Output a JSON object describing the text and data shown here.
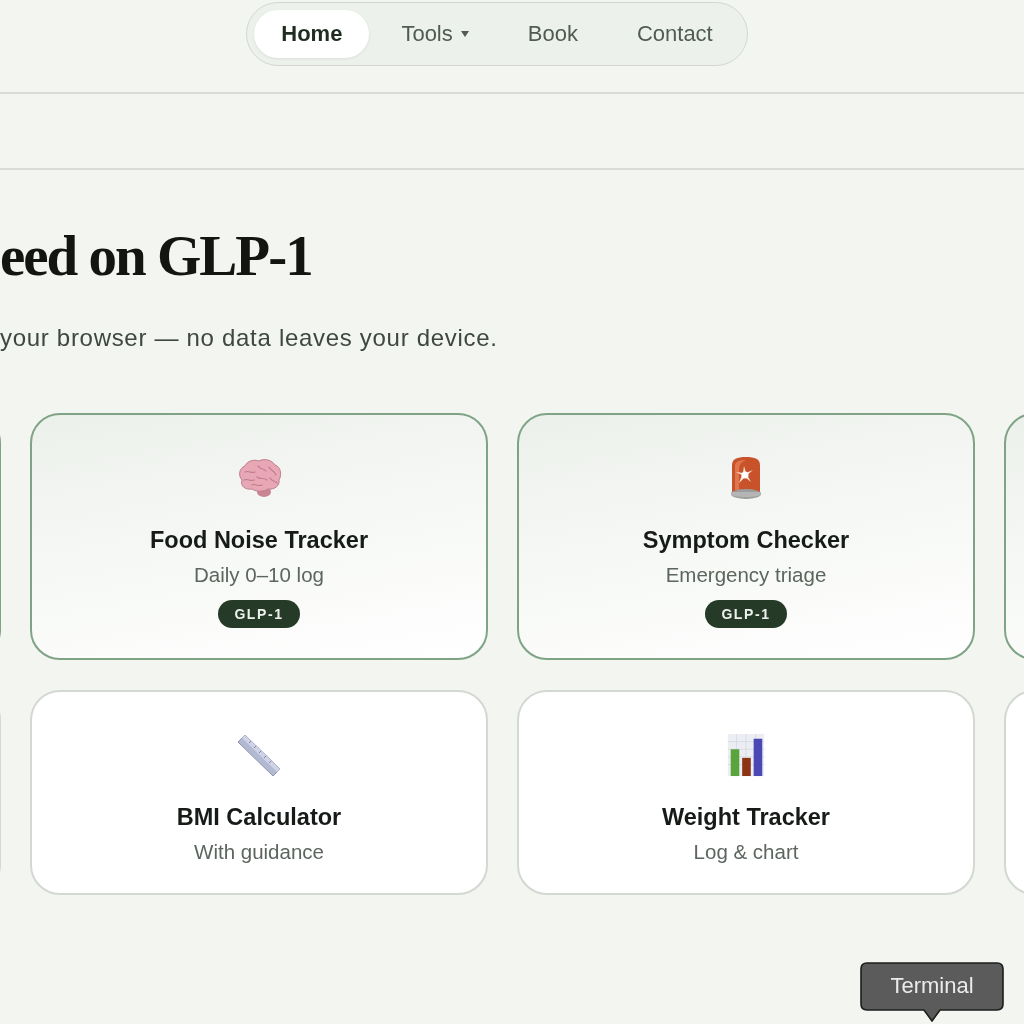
{
  "nav": {
    "items": [
      {
        "label": "Home",
        "selected": true,
        "dropdown": false
      },
      {
        "label": "Tools",
        "selected": false,
        "dropdown": true
      },
      {
        "label": "Book",
        "selected": false,
        "dropdown": false
      },
      {
        "label": "Contact",
        "selected": false,
        "dropdown": false
      }
    ]
  },
  "hero": {
    "title": "eed on GLP-1",
    "subtitle": "your browser — no data leaves your device."
  },
  "tool_rows": [
    {
      "cards": [
        {
          "highlighted": true
        },
        {
          "title": "Food Noise Tracker",
          "subtitle": "Daily 0–10 log",
          "tag": "GLP-1",
          "highlighted": true
        },
        {
          "title": "Symptom Checker",
          "subtitle": "Emergency triage",
          "tag": "GLP-1",
          "highlighted": true
        },
        {
          "highlighted": true
        }
      ]
    },
    {
      "cards": [
        {
          "highlighted": false
        },
        {
          "title": "BMI Calculator",
          "subtitle": "With guidance",
          "highlighted": false
        },
        {
          "title": "Weight Tracker",
          "subtitle": "Log & chart",
          "highlighted": false
        },
        {
          "highlighted": false
        }
      ]
    }
  ],
  "tooltip": {
    "text": "Terminal"
  }
}
